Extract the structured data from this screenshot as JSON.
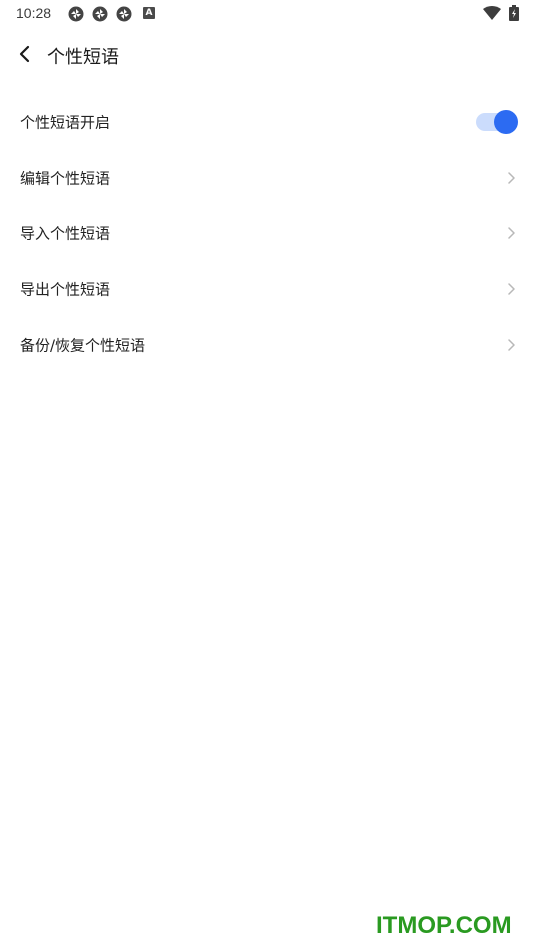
{
  "status_bar": {
    "time": "10:28",
    "notification_icons": [
      "aperture-icon",
      "aperture-icon",
      "aperture-icon"
    ],
    "a_badge": "A",
    "wifi_icon": "wifi-icon",
    "battery_icon": "battery-charging-icon"
  },
  "header": {
    "back_icon": "back-arrow-icon",
    "title": "个性短语"
  },
  "settings": {
    "items": [
      {
        "label": "个性短语开启",
        "control": "toggle",
        "enabled": true
      },
      {
        "label": "编辑个性短语",
        "control": "chevron"
      },
      {
        "label": "导入个性短语",
        "control": "chevron"
      },
      {
        "label": "导出个性短语",
        "control": "chevron"
      },
      {
        "label": "备份/恢复个性短语",
        "control": "chevron"
      }
    ]
  },
  "colors": {
    "toggle_on": "#2c6bf2",
    "toggle_track": "#cbdcfc",
    "watermark": "#2a9a21"
  },
  "watermark": "ITMOP.COM"
}
